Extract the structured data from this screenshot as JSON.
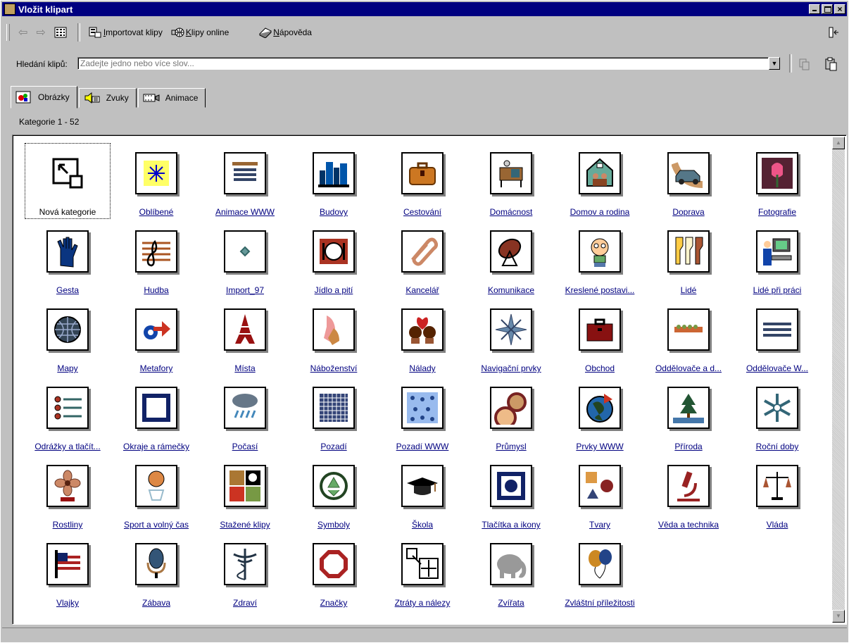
{
  "window": {
    "title": "Vložit klipart"
  },
  "toolbar": {
    "back_glyph": "⇦",
    "forward_glyph": "⇨",
    "import_label": "mportovat klipy",
    "import_mnemonic": "I",
    "online_label": "lipy online",
    "online_mnemonic": "K",
    "help_label": "ápověda",
    "help_mnemonic": "N"
  },
  "search": {
    "label": "Hledání klipů:",
    "placeholder": "Zadejte jedno nebo více slov..."
  },
  "tabs": [
    {
      "label": "Obrázky",
      "active": true
    },
    {
      "label": "Zvuky",
      "active": false
    },
    {
      "label": "Animace",
      "active": false
    }
  ],
  "category_count": "Kategorie 1 - 52",
  "categories": [
    {
      "label": "Nová kategorie",
      "icon": "new-category-icon"
    },
    {
      "label": "Oblíbené",
      "icon": "favorites-icon"
    },
    {
      "label": "Animace WWW",
      "icon": "web-animation-icon"
    },
    {
      "label": "Budovy",
      "icon": "buildings-icon"
    },
    {
      "label": "Cestování",
      "icon": "suitcase-icon"
    },
    {
      "label": "Domácnost",
      "icon": "household-icon"
    },
    {
      "label": "Domov a rodina",
      "icon": "home-family-icon"
    },
    {
      "label": "Doprava",
      "icon": "car-icon"
    },
    {
      "label": "Fotografie",
      "icon": "photo-tulip-icon"
    },
    {
      "label": "Gesta",
      "icon": "hand-icon"
    },
    {
      "label": "Hudba",
      "icon": "music-clef-icon"
    },
    {
      "label": "Import_97",
      "icon": "import-diamond-icon"
    },
    {
      "label": "Jídlo a pití",
      "icon": "plate-icon"
    },
    {
      "label": "Kancelář",
      "icon": "paperclip-icon"
    },
    {
      "label": "Komunikace",
      "icon": "satellite-dish-icon"
    },
    {
      "label": "Kreslené postavi...",
      "icon": "cartoon-character-icon"
    },
    {
      "label": "Lidé",
      "icon": "people-icon"
    },
    {
      "label": "Lidé při práci",
      "icon": "people-working-icon"
    },
    {
      "label": "Mapy",
      "icon": "globe-icon"
    },
    {
      "label": "Metafory",
      "icon": "metaphor-arrow-icon"
    },
    {
      "label": "Místa",
      "icon": "eiffel-tower-icon"
    },
    {
      "label": "Náboženství",
      "icon": "religion-hands-icon"
    },
    {
      "label": "Nálady",
      "icon": "couple-heart-icon"
    },
    {
      "label": "Navigační prvky",
      "icon": "compass-star-icon"
    },
    {
      "label": "Obchod",
      "icon": "briefcase-icon"
    },
    {
      "label": "Oddělovače a d...",
      "icon": "divider-icon"
    },
    {
      "label": "Oddělovače W...",
      "icon": "web-divider-icon"
    },
    {
      "label": "Odrážky a tlačít...",
      "icon": "bullets-icon"
    },
    {
      "label": "Okraje a rámečky",
      "icon": "frame-icon"
    },
    {
      "label": "Počasí",
      "icon": "weather-cloud-icon"
    },
    {
      "label": "Pozadí",
      "icon": "background-grid-icon"
    },
    {
      "label": "Pozadí WWW",
      "icon": "web-background-icon"
    },
    {
      "label": "Průmysl",
      "icon": "gears-icon"
    },
    {
      "label": "Prvky WWW",
      "icon": "web-globe-icon"
    },
    {
      "label": "Příroda",
      "icon": "tree-icon"
    },
    {
      "label": "Roční doby",
      "icon": "snowflake-icon"
    },
    {
      "label": "Rostliny",
      "icon": "flower-icon"
    },
    {
      "label": "Sport a volný čas",
      "icon": "basketball-icon"
    },
    {
      "label": "Stažené klipy",
      "icon": "downloaded-clips-icon"
    },
    {
      "label": "Symboly",
      "icon": "recycle-icon"
    },
    {
      "label": "Škola",
      "icon": "graduation-cap-icon"
    },
    {
      "label": "Tlačítka a ikony",
      "icon": "button-icon"
    },
    {
      "label": "Tvary",
      "icon": "shapes-icon"
    },
    {
      "label": "Věda a technika",
      "icon": "microscope-icon"
    },
    {
      "label": "Vláda",
      "icon": "scales-icon"
    },
    {
      "label": "Vlajky",
      "icon": "flag-icon"
    },
    {
      "label": "Zábava",
      "icon": "microphone-icon"
    },
    {
      "label": "Zdraví",
      "icon": "caduceus-icon"
    },
    {
      "label": "Značky",
      "icon": "sign-octagon-icon"
    },
    {
      "label": "Ztráty a nálezy",
      "icon": "lost-found-icon"
    },
    {
      "label": "Zvířata",
      "icon": "elephant-icon"
    },
    {
      "label": "Zvláštní příležitosti",
      "icon": "balloons-icon"
    }
  ],
  "colors": {
    "title_bar": "#000080",
    "link": "#000080",
    "face": "#c0c0c0"
  }
}
